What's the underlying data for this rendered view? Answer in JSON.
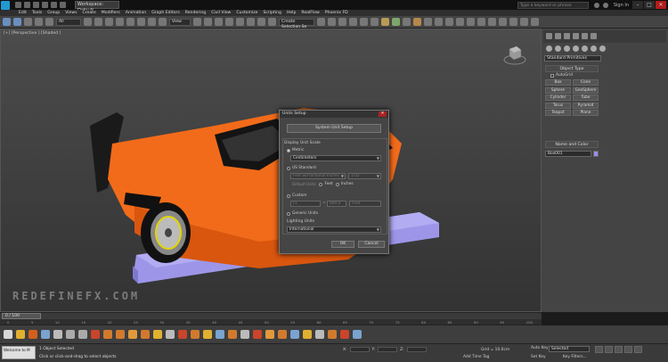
{
  "titlebar": {
    "workspace": "Workspace: Default",
    "search_placeholder": "Type a keyword or phrase",
    "sign_in": "Sign In",
    "window_buttons": [
      "–",
      "□",
      "✕"
    ]
  },
  "menu": [
    "Edit",
    "Tools",
    "Group",
    "Views",
    "Create",
    "Modifiers",
    "Animation",
    "Graph Editors",
    "Rendering",
    "Civil View",
    "Customize",
    "Scripting",
    "Help",
    "RealFlow",
    "Phoenix FD"
  ],
  "toolbar": {
    "filter": "All",
    "view": "View",
    "selection_set": "Create Selection Se"
  },
  "viewport": {
    "label": "[+] [Perspective ] [Shaded ]",
    "watermark": "REDEFINEFX.COM"
  },
  "command_panel": {
    "category": "Standard Primitives",
    "object_type_title": "Object Type",
    "autogrid": "AutoGrid",
    "object_types": [
      "Box",
      "Cone",
      "Sphere",
      "GeoSphere",
      "Cylinder",
      "Tube",
      "Torus",
      "Pyramid",
      "Teapot",
      "Plane"
    ],
    "name_color_title": "Name and Color",
    "object_name": "Box001",
    "object_color": "#9a8ee8"
  },
  "dialog": {
    "title": "Units Setup",
    "close": "✕",
    "system_unit_setup": "System Unit Setup",
    "display_unit_scale": "Display Unit Scale",
    "metric": "Metric",
    "metric_value": "Centimeters",
    "us_standard": "US Standard",
    "us_value": "Feet w/Fractional Inches",
    "us_fraction": "1/32",
    "default_units": "Default Units:",
    "feet": "Feet",
    "inches": "Inches",
    "custom": "Custom",
    "custom_name": "FL",
    "custom_eq": "=",
    "custom_value": "660.0",
    "custom_unit": "Feet",
    "generic_units": "Generic Units",
    "lighting_units": "Lighting Units",
    "lighting_value": "International",
    "ok": "OK",
    "cancel": "Cancel"
  },
  "timeline": {
    "frame": "0 / 100",
    "ruler_ticks": [
      "0",
      "5",
      "10",
      "15",
      "20",
      "25",
      "30",
      "35",
      "40",
      "45",
      "50",
      "55",
      "60",
      "65",
      "70",
      "75",
      "80",
      "85",
      "90",
      "95",
      "100"
    ]
  },
  "status": {
    "maxscript": "Welcome to M",
    "line1": "1 Object Selected",
    "line2": "Click or click-and-drag to select objects",
    "x_label": "X:",
    "y_label": "Y:",
    "z_label": "Z:",
    "grid": "Grid = 10.0cm",
    "add_time_tag": "Add Time Tag",
    "auto_key": "Auto Key",
    "set_key": "Set Key",
    "selected": "Selected",
    "key_filters": "Key Filters..."
  }
}
